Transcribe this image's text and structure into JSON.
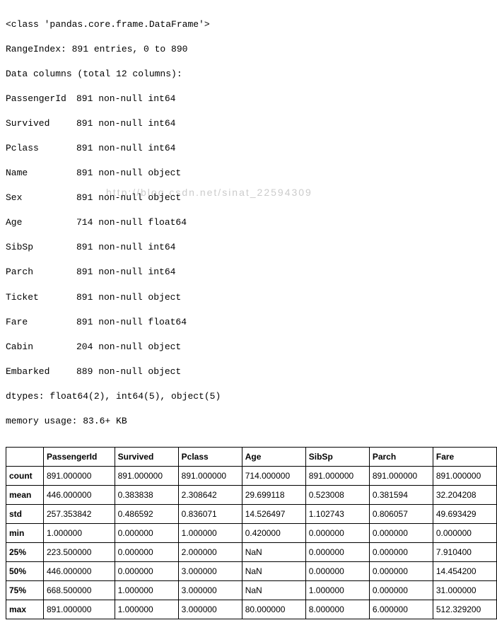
{
  "info": {
    "header1": "<class 'pandas.core.frame.DataFrame'>",
    "header2": "RangeIndex: 891 entries, 0 to 890",
    "header3": "Data columns (total 12 columns):",
    "columns": [
      {
        "name": "PassengerId",
        "detail": "891 non-null int64"
      },
      {
        "name": "Survived",
        "detail": "891 non-null int64"
      },
      {
        "name": "Pclass",
        "detail": "891 non-null int64"
      },
      {
        "name": "Name",
        "detail": "891 non-null object"
      },
      {
        "name": "Sex",
        "detail": "891 non-null object"
      },
      {
        "name": "Age",
        "detail": "714 non-null float64"
      },
      {
        "name": "SibSp",
        "detail": "891 non-null int64"
      },
      {
        "name": "Parch",
        "detail": "891 non-null int64"
      },
      {
        "name": "Ticket",
        "detail": "891 non-null object"
      },
      {
        "name": "Fare",
        "detail": "891 non-null float64"
      },
      {
        "name": "Cabin",
        "detail": "204 non-null object"
      },
      {
        "name": "Embarked",
        "detail": "889 non-null object"
      }
    ],
    "dtypes": "dtypes: float64(2), int64(5), object(5)",
    "memory": "memory usage: 83.6+ KB"
  },
  "watermark": "http://blog.csdn.net/sinat_22594309",
  "describe": {
    "headers": [
      "",
      "PassengerId",
      "Survived",
      "Pclass",
      "Age",
      "SibSp",
      "Parch",
      "Fare"
    ],
    "rows": [
      {
        "label": "count",
        "values": [
          "891.000000",
          "891.000000",
          "891.000000",
          "714.000000",
          "891.000000",
          "891.000000",
          "891.000000"
        ]
      },
      {
        "label": "mean",
        "values": [
          "446.000000",
          "0.383838",
          "2.308642",
          "29.699118",
          "0.523008",
          "0.381594",
          "32.204208"
        ]
      },
      {
        "label": "std",
        "values": [
          "257.353842",
          "0.486592",
          "0.836071",
          "14.526497",
          "1.102743",
          "0.806057",
          "49.693429"
        ]
      },
      {
        "label": "min",
        "values": [
          "1.000000",
          "0.000000",
          "1.000000",
          "0.420000",
          "0.000000",
          "0.000000",
          "0.000000"
        ]
      },
      {
        "label": "25%",
        "values": [
          "223.500000",
          "0.000000",
          "2.000000",
          "NaN",
          "0.000000",
          "0.000000",
          "7.910400"
        ]
      },
      {
        "label": "50%",
        "values": [
          "446.000000",
          "0.000000",
          "3.000000",
          "NaN",
          "0.000000",
          "0.000000",
          "14.454200"
        ]
      },
      {
        "label": "75%",
        "values": [
          "668.500000",
          "1.000000",
          "3.000000",
          "NaN",
          "1.000000",
          "0.000000",
          "31.000000"
        ]
      },
      {
        "label": "max",
        "values": [
          "891.000000",
          "1.000000",
          "3.000000",
          "80.000000",
          "8.000000",
          "6.000000",
          "512.329200"
        ]
      }
    ]
  }
}
